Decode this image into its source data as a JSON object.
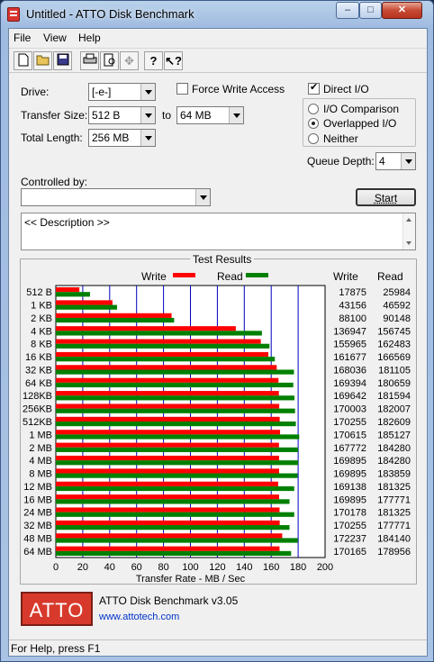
{
  "window": {
    "title": "Untitled - ATTO Disk Benchmark"
  },
  "menu": [
    "File",
    "View",
    "Help"
  ],
  "form": {
    "drive_label": "Drive:",
    "drive_value": "[-e-]",
    "force_write_label": "Force Write Access",
    "force_write_checked": false,
    "direct_io_label": "Direct I/O",
    "direct_io_checked": true,
    "transfer_size_label": "Transfer Size:",
    "transfer_from": "512 B",
    "to_label": "to",
    "transfer_to": "64 MB",
    "total_length_label": "Total Length:",
    "total_length_value": "256 MB",
    "io_options": [
      "I/O Comparison",
      "Overlapped I/O",
      "Neither"
    ],
    "io_selected": "Overlapped I/O",
    "queue_depth_label": "Queue Depth:",
    "queue_depth_value": "4",
    "controlled_by_label": "Controlled by:",
    "controlled_by_value": "",
    "start_label": "Start",
    "description": "<< Description >>"
  },
  "results": {
    "title": "Test Results",
    "legend_write": "Write",
    "legend_read": "Read",
    "col_write": "Write",
    "col_read": "Read",
    "write_color": "#ff0000",
    "read_color": "#008000"
  },
  "chart_data": {
    "type": "bar",
    "orientation": "horizontal",
    "xlabel": "Transfer Rate - MB / Sec",
    "xlim": [
      0,
      200
    ],
    "xticks": [
      "0",
      "20",
      "40",
      "60",
      "80",
      "100",
      "120",
      "140",
      "160",
      "180",
      "200"
    ],
    "grid": true,
    "categories": [
      "512 B",
      "1 KB",
      "2 KB",
      "4 KB",
      "8 KB",
      "16 KB",
      "32 KB",
      "64 KB",
      "128KB",
      "256KB",
      "512KB",
      "1 MB",
      "2 MB",
      "4 MB",
      "8 MB",
      "12 MB",
      "16 MB",
      "24 MB",
      "32 MB",
      "48 MB",
      "64 MB"
    ],
    "series": [
      {
        "name": "Write",
        "values": [
          17.5,
          42.1,
          86.0,
          133.7,
          152.3,
          157.9,
          164.1,
          165.4,
          165.7,
          166.0,
          166.3,
          166.6,
          165.8,
          165.9,
          165.9,
          165.2,
          165.9,
          166.2,
          166.3,
          168.2,
          166.2
        ],
        "labels": [
          "17875",
          "43156",
          "88100",
          "136947",
          "155965",
          "161677",
          "168036",
          "169394",
          "169642",
          "170003",
          "170255",
          "170615",
          "167772",
          "169895",
          "169895",
          "169138",
          "169895",
          "170178",
          "170255",
          "172237",
          "170165"
        ]
      },
      {
        "name": "Read",
        "values": [
          25.4,
          45.5,
          87.9,
          153.1,
          158.7,
          162.7,
          176.9,
          176.4,
          177.3,
          177.7,
          178.3,
          180.8,
          180.0,
          180.0,
          179.6,
          177.1,
          173.6,
          177.1,
          173.6,
          179.8,
          174.8
        ],
        "labels": [
          "25984",
          "46592",
          "90148",
          "156745",
          "162483",
          "166569",
          "181105",
          "180659",
          "181594",
          "182007",
          "182609",
          "185127",
          "184280",
          "184280",
          "183859",
          "181325",
          "177771",
          "181325",
          "177771",
          "184140",
          "178956"
        ]
      }
    ]
  },
  "footer": {
    "logo_text": "ATTO",
    "product": "ATTO Disk Benchmark v3.05",
    "url": "www.attotech.com"
  },
  "status": "For Help, press F1"
}
